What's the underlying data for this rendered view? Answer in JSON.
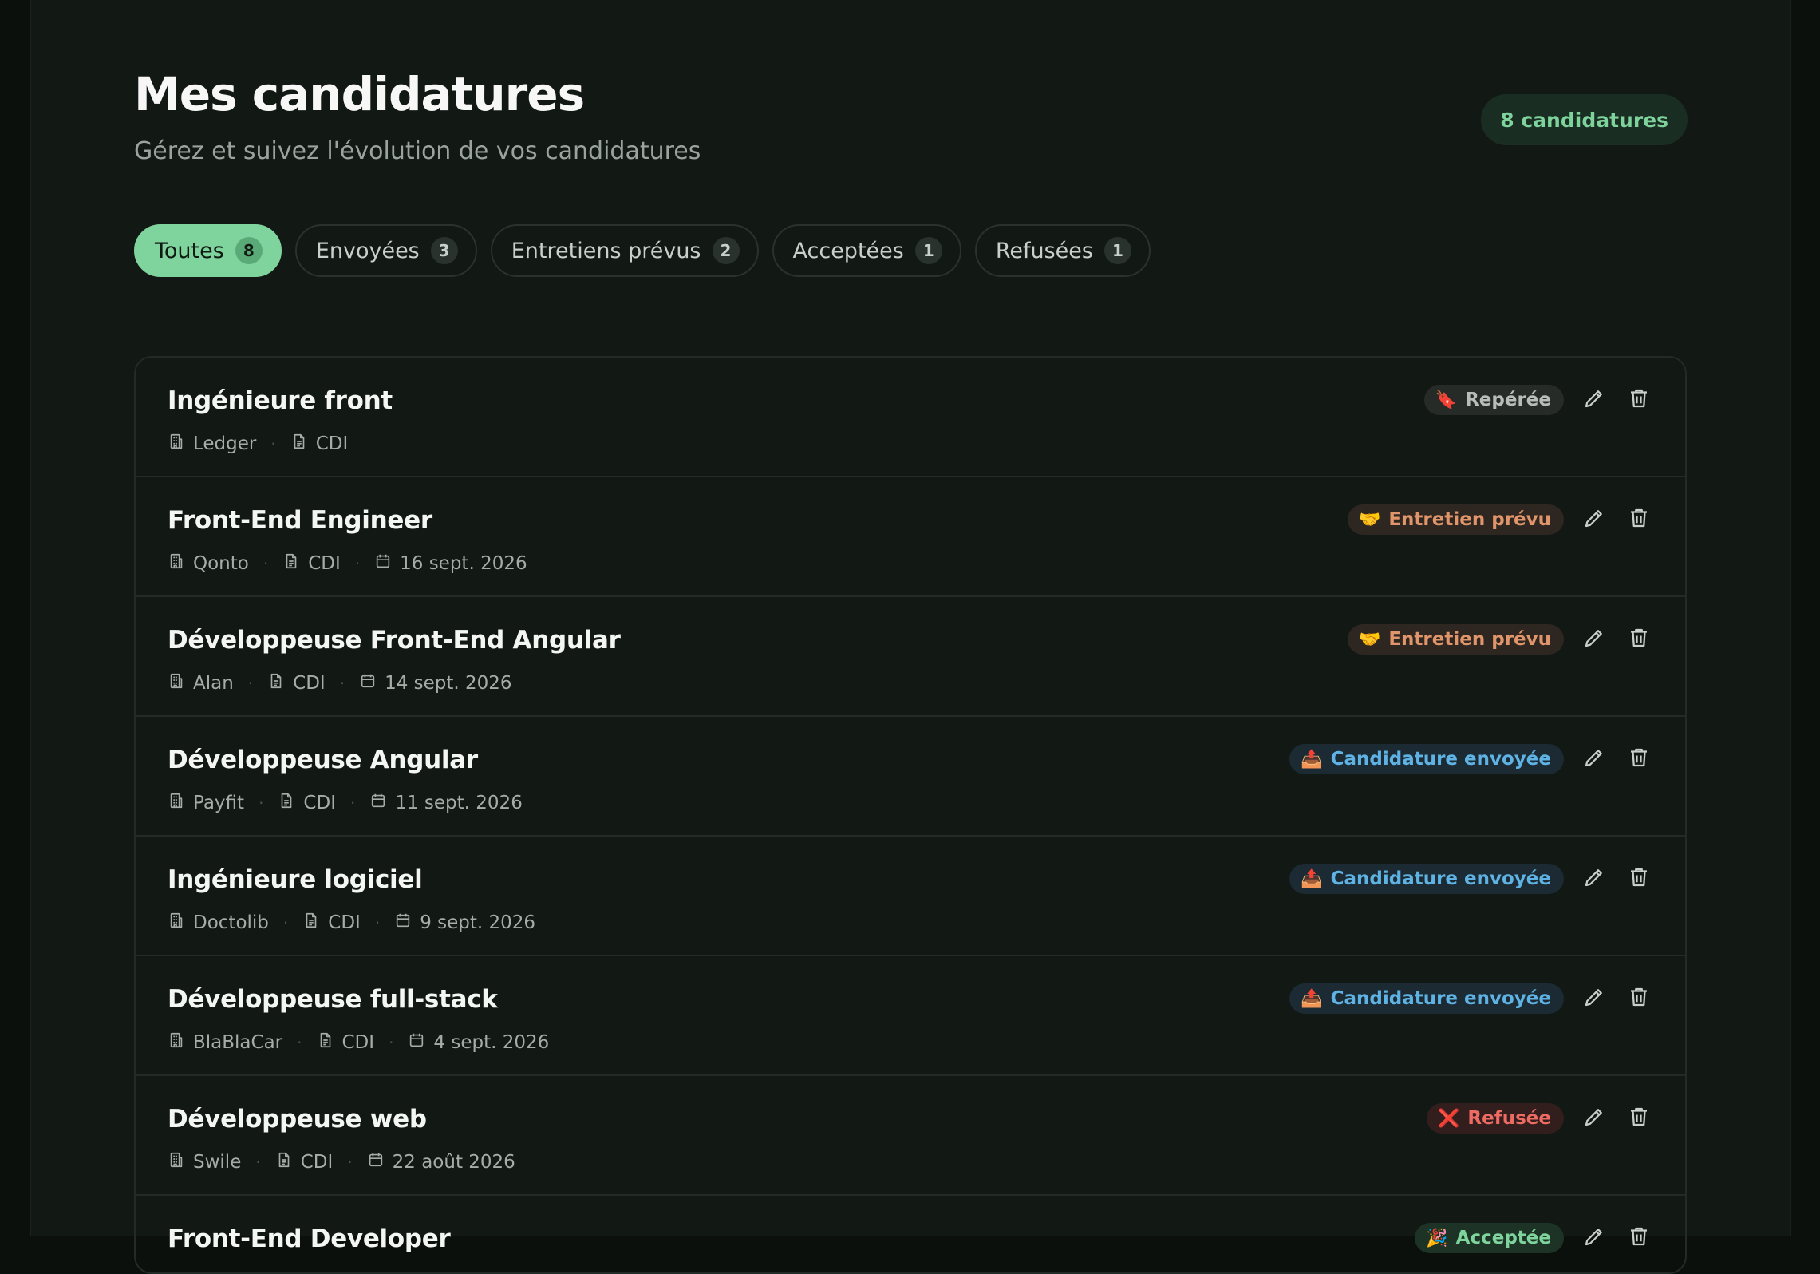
{
  "header": {
    "title": "Mes candidatures",
    "subtitle": "Gérez et suivez l'évolution de vos candidatures",
    "count_badge": "8 candidatures"
  },
  "tabs": [
    {
      "label": "Toutes",
      "count": "8",
      "active": true
    },
    {
      "label": "Envoyées",
      "count": "3",
      "active": false
    },
    {
      "label": "Entretiens prévus",
      "count": "2",
      "active": false
    },
    {
      "label": "Acceptées",
      "count": "1",
      "active": false
    },
    {
      "label": "Refusées",
      "count": "1",
      "active": false
    }
  ],
  "status_styles": {
    "reperee": {
      "bg": "#262b28",
      "fg": "#b7bdb9",
      "emoji": "🔖"
    },
    "entretien": {
      "bg": "#2e2620",
      "fg": "#e0956a",
      "emoji": "🤝"
    },
    "envoyee": {
      "bg": "#1b2a33",
      "fg": "#5fb3e4",
      "emoji": "📤"
    },
    "refusee": {
      "bg": "#331e1e",
      "fg": "#ee6b63",
      "emoji": "❌"
    },
    "acceptee": {
      "bg": "#1d3325",
      "fg": "#7fd39c",
      "emoji": "🎉"
    }
  },
  "applications": [
    {
      "title": "Ingénieure front",
      "company": "Ledger",
      "contract": "CDI",
      "date": "",
      "status": "Repérée",
      "status_key": "reperee"
    },
    {
      "title": "Front-End Engineer",
      "company": "Qonto",
      "contract": "CDI",
      "date": "16 sept. 2026",
      "status": "Entretien prévu",
      "status_key": "entretien"
    },
    {
      "title": "Développeuse Front-End Angular",
      "company": "Alan",
      "contract": "CDI",
      "date": "14 sept. 2026",
      "status": "Entretien prévu",
      "status_key": "entretien"
    },
    {
      "title": "Développeuse Angular",
      "company": "Payfit",
      "contract": "CDI",
      "date": "11 sept. 2026",
      "status": "Candidature envoyée",
      "status_key": "envoyee"
    },
    {
      "title": "Ingénieure logiciel",
      "company": "Doctolib",
      "contract": "CDI",
      "date": "9 sept. 2026",
      "status": "Candidature envoyée",
      "status_key": "envoyee"
    },
    {
      "title": "Développeuse full-stack",
      "company": "BlaBlaCar",
      "contract": "CDI",
      "date": "4 sept. 2026",
      "status": "Candidature envoyée",
      "status_key": "envoyee"
    },
    {
      "title": "Développeuse web",
      "company": "Swile",
      "contract": "CDI",
      "date": "22 août 2026",
      "status": "Refusée",
      "status_key": "refusee"
    },
    {
      "title": "Front-End Developer",
      "company": "",
      "contract": "",
      "date": "",
      "status": "Acceptée",
      "status_key": "acceptee"
    }
  ],
  "icons": {
    "company": "building-icon",
    "contract": "document-icon",
    "date": "calendar-icon",
    "edit": "pencil-icon",
    "delete": "trash-icon"
  }
}
